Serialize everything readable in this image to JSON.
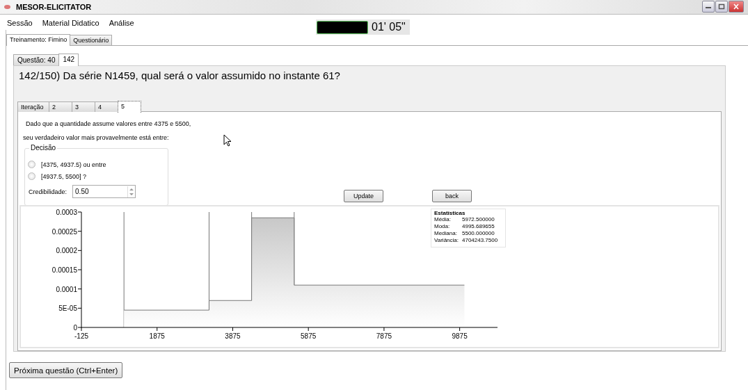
{
  "window": {
    "title": "MESOR-ELICITATOR"
  },
  "menu": [
    "Sessão",
    "Material Didatico",
    "Análise"
  ],
  "timer": {
    "reading": "01' 05\""
  },
  "tabs": [
    {
      "label": "Treinamento: Fimino",
      "selected": true
    },
    {
      "label": "Questionário",
      "selected": false
    }
  ],
  "question_tabs": [
    {
      "label": "Questão: 40",
      "selected": false
    },
    {
      "label": "142",
      "selected": true
    }
  ],
  "question": "142/150) Da série N1459, qual será o valor assumido no instante 61?",
  "iteration_tabs": [
    {
      "label": "Iteração",
      "selected": false
    },
    {
      "label": "2",
      "selected": false
    },
    {
      "label": "3",
      "selected": false
    },
    {
      "label": "4",
      "selected": false
    },
    {
      "label": "5",
      "selected": true
    }
  ],
  "prompt_lines": [
    "Dado que a quantidade assume valores entre 4375 e 5500,",
    "seu verdadeiro valor mais provavelmente está entre:"
  ],
  "decision": {
    "title": "Decisão",
    "options": [
      {
        "label": "[4375, 4937.5) ou entre",
        "selected": false
      },
      {
        "label": "[4937.5, 5500] ?",
        "selected": false
      }
    ],
    "credibility_label": "Credibilidade:",
    "credibility_value": "0.50"
  },
  "buttons": [
    "Update",
    "back"
  ],
  "chart": {
    "chart_data": {
      "type": "area",
      "x": [
        1000,
        3250,
        3250,
        4375,
        4375,
        5500,
        5500,
        10000
      ],
      "series": [
        {
          "color": "#c8c8c8",
          "values": [
            4.5e-05,
            4.5e-05,
            7e-05,
            7e-05,
            0.000285,
            0.000285,
            0.00011,
            0.00011
          ]
        }
      ],
      "ref_lines": [
        {
          "axis": "x",
          "value": 1000
        },
        {
          "axis": "x",
          "value": 3250
        },
        {
          "axis": "x",
          "value": 4375
        },
        {
          "axis": "x",
          "value": 5500
        }
      ],
      "xlim": [
        -125,
        10875
      ],
      "ylim": [
        0,
        0.0003
      ],
      "xticks": [
        -125,
        1875,
        3875,
        5875,
        7875,
        9875
      ],
      "yticks": [
        {
          "value": 0,
          "label": "0"
        },
        {
          "value": 5e-05,
          "label": "5E-05"
        },
        {
          "value": 0.0001,
          "label": "0.0001"
        },
        {
          "value": 0.00015,
          "label": "0.00015"
        },
        {
          "value": 0.0002,
          "label": "0.0002"
        },
        {
          "value": 0.00025,
          "label": "0.00025"
        },
        {
          "value": 0.0003,
          "label": "0.0003"
        }
      ]
    },
    "stats": {
      "title": "Estatísticas",
      "rows": [
        {
          "label": "Média:",
          "value": "5972.500000"
        },
        {
          "label": "Moda:",
          "value": "4995.689655"
        },
        {
          "label": "Mediana:",
          "value": "5500.000000"
        },
        {
          "label": "Variância:",
          "value": "4704243.7500"
        }
      ]
    }
  },
  "next_button": "Próxima questão (Ctrl+Enter)"
}
